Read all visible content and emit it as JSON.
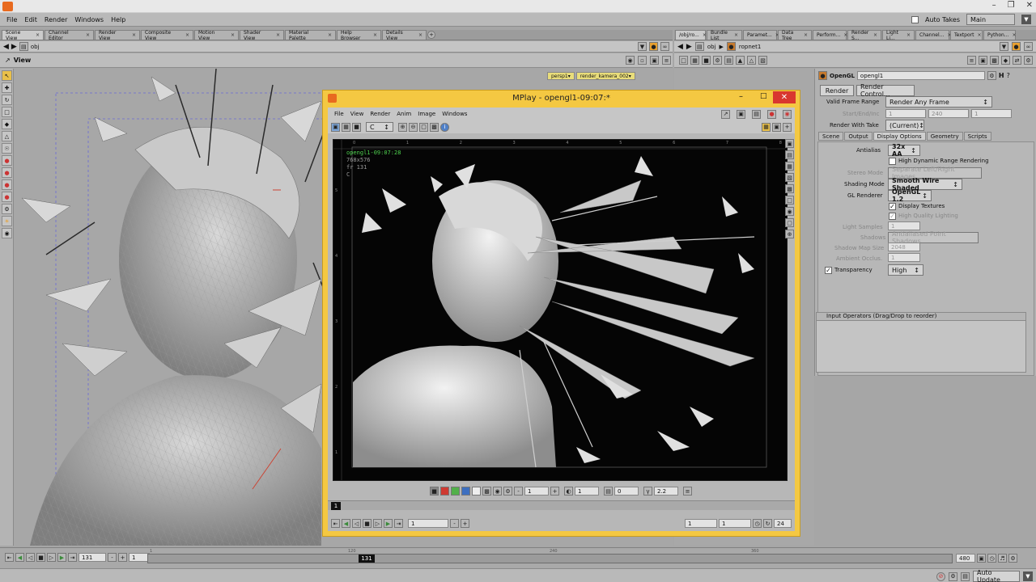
{
  "app": {
    "menu": [
      "File",
      "Edit",
      "Render",
      "Windows",
      "Help"
    ],
    "auto_takes": "Auto Takes",
    "desktop": "Main"
  },
  "left_tabs": [
    "Scene View",
    "Channel Editor",
    "Render View",
    "Composite View",
    "Motion View",
    "Shader View",
    "Material Palette",
    "Help Browser",
    "Details View"
  ],
  "right_tabs": [
    "/obj/ro...",
    "Bundle List",
    "Paramet...",
    "Data Tree",
    "Perform...",
    "Render S...",
    "Light Li...",
    "Channel...",
    "Textport",
    "Python..."
  ],
  "left_path": "obj",
  "right_path": [
    "obj",
    "ropnet1"
  ],
  "view": {
    "label": "View",
    "camera": "persp1",
    "render_cam": "render_kamera_002"
  },
  "mplay": {
    "title": "MPlay - opengl1-09:07:*",
    "menu": [
      "File",
      "View",
      "Render",
      "Anim",
      "Image",
      "Windows"
    ],
    "channel": "C",
    "overlay": {
      "name": "opengl1-09:07:28",
      "res": "768x576",
      "frame": "fr 131",
      "channel": "C"
    },
    "controls": {
      "frame_field": "1",
      "exposure": "1",
      "offset": "0",
      "gamma": "2.2"
    },
    "frame_marker": "1",
    "play": {
      "start": "1",
      "range_a": "1",
      "range_b": "1",
      "fps": "24"
    },
    "ruler": [
      "0",
      "1",
      "2",
      "3",
      "4",
      "5",
      "6",
      "7",
      "8"
    ],
    "vruler": [
      "5",
      "4",
      "3",
      "2",
      "1"
    ]
  },
  "params": {
    "node_type": "OpenGL",
    "node_name": "opengl1",
    "render_btn": "Render",
    "render_control_btn": "Render Control...",
    "valid_frame_range_label": "Valid Frame Range",
    "valid_frame_range": "Render Any Frame",
    "start_end_label": "Start/End/Inc",
    "start_end": [
      "1",
      "240",
      "1"
    ],
    "render_with_take_label": "Render With Take",
    "render_with_take": "(Current)",
    "tabs": [
      "Scene",
      "Output",
      "Display Options",
      "Geometry",
      "Scripts"
    ],
    "antialias_label": "Antialias",
    "antialias": "32x AA",
    "hdr_label": "High Dynamic Range Rendering",
    "stereo_label": "Stereo Mode",
    "stereo": "Separate Left/Right Images",
    "shading_label": "Shading Mode",
    "shading": "Smooth Wire Shaded",
    "gl_renderer_label": "GL Renderer",
    "gl_renderer": "OpenGL 1.2",
    "display_textures": "Display Textures",
    "hq_lighting": "High Quality Lighting",
    "light_samples_label": "Light Samples",
    "light_samples": "1",
    "shadows_label": "Shadows",
    "shadows": "Antialiased Point Shadows",
    "shadow_map_label": "Shadow Map Size",
    "shadow_map": "2048",
    "ambient_occ_label": "Ambient Occlus.",
    "ambient_occ": "1",
    "transparency_label": "Transparency",
    "transparency": "High",
    "input_ops": "Input Operators (Drag/Drop to reorder)"
  },
  "timeline": {
    "current_frame": "131",
    "step": "1",
    "marker": "131",
    "ticks": [
      "1",
      "120",
      "240",
      "360"
    ],
    "end": "480"
  },
  "status": {
    "auto_update": "Auto Update"
  },
  "colors": {
    "mplay_frame": "#f4c842",
    "houdini_orange": "#e86a1f",
    "overlay_text": "#4fd24f",
    "close_red": "#d9372f"
  }
}
